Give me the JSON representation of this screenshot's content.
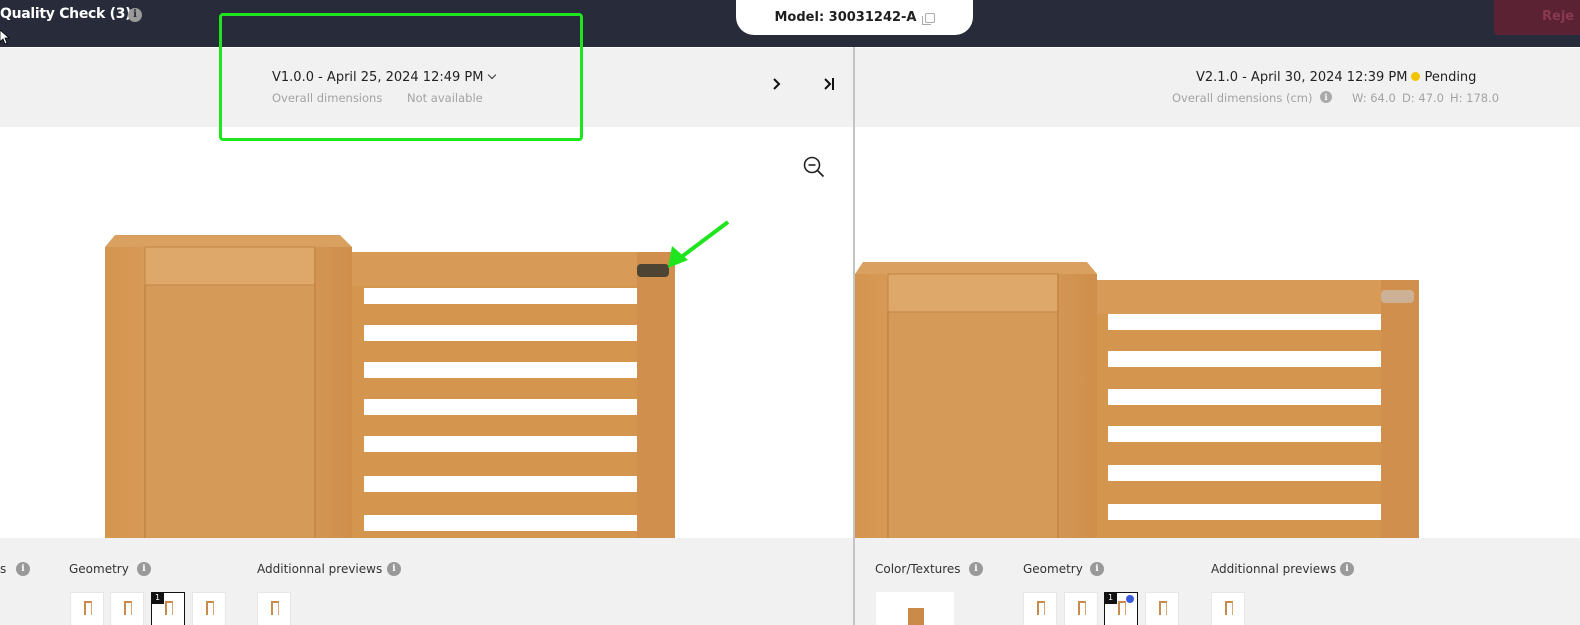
{
  "topbar": {
    "title": "Quality Check (3)",
    "info_icon": "info-icon",
    "model_label": "Model: 30031242-A",
    "copy_icon": "copy-icon",
    "reject_label": "Reje"
  },
  "left_panel": {
    "version_label": "V1.0.0 - April 25, 2024 12:49 PM",
    "dimensions_label": "Overall dimensions",
    "dimensions_value": "Not available",
    "next_icon": ">",
    "last_icon": ">"
  },
  "right_panel": {
    "version_label": "V2.1.0 - April 30, 2024 12:39 PM",
    "status": "Pending",
    "status_color": "#f2c400",
    "dimensions_label": "Overall dimensions (cm)",
    "width": "W: 64.0",
    "depth": "D: 47.0",
    "height": "H: 178.0"
  },
  "left_bottom": {
    "color_textures_partial": "s",
    "geometry_label": "Geometry",
    "previews_label": "Additionnal previews",
    "selected_thumb_number": "1"
  },
  "right_bottom": {
    "color_textures_label": "Color/Textures",
    "geometry_label": "Geometry",
    "previews_label": "Additionnal previews",
    "selected_thumb_number": "1"
  },
  "colors": {
    "topbar_bg": "#272b3a",
    "annotation": "#1ee51e",
    "wood": "#d89c5c",
    "panel_bg": "#f1f1f1"
  },
  "info_glyph": "i"
}
